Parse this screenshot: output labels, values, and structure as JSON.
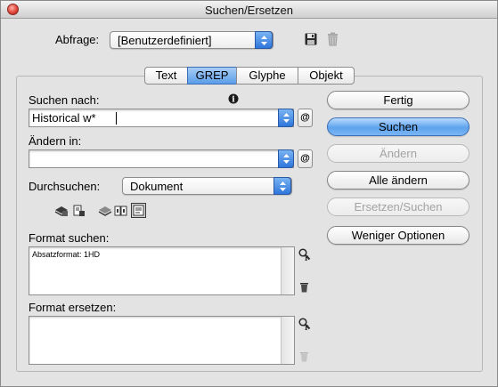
{
  "window": {
    "title": "Suchen/Ersetzen"
  },
  "query": {
    "label": "Abfrage:",
    "value": "[Benutzerdefiniert]"
  },
  "tabs": [
    {
      "label": "Text",
      "selected": false
    },
    {
      "label": "GREP",
      "selected": true
    },
    {
      "label": "Glyphe",
      "selected": false
    },
    {
      "label": "Objekt",
      "selected": false
    }
  ],
  "find": {
    "label": "Suchen nach:",
    "value": "Historical w*"
  },
  "change": {
    "label": "Ändern in:",
    "value": ""
  },
  "search_in": {
    "label": "Durchsuchen:",
    "value": "Dokument"
  },
  "format_find": {
    "label": "Format suchen:",
    "value": "Absatzformat: 1HD"
  },
  "format_change": {
    "label": "Format ersetzen:",
    "value": ""
  },
  "buttons": {
    "done": "Fertig",
    "find": "Suchen",
    "change": "Ändern",
    "change_all": "Alle ändern",
    "change_find": "Ersetzen/Suchen",
    "fewer_options": "Weniger Optionen"
  },
  "icons": {
    "special_char": "@",
    "info": "i"
  },
  "colors": {
    "accent_blue": "#5ea3ee",
    "disabled_text": "#a3a3a3"
  }
}
